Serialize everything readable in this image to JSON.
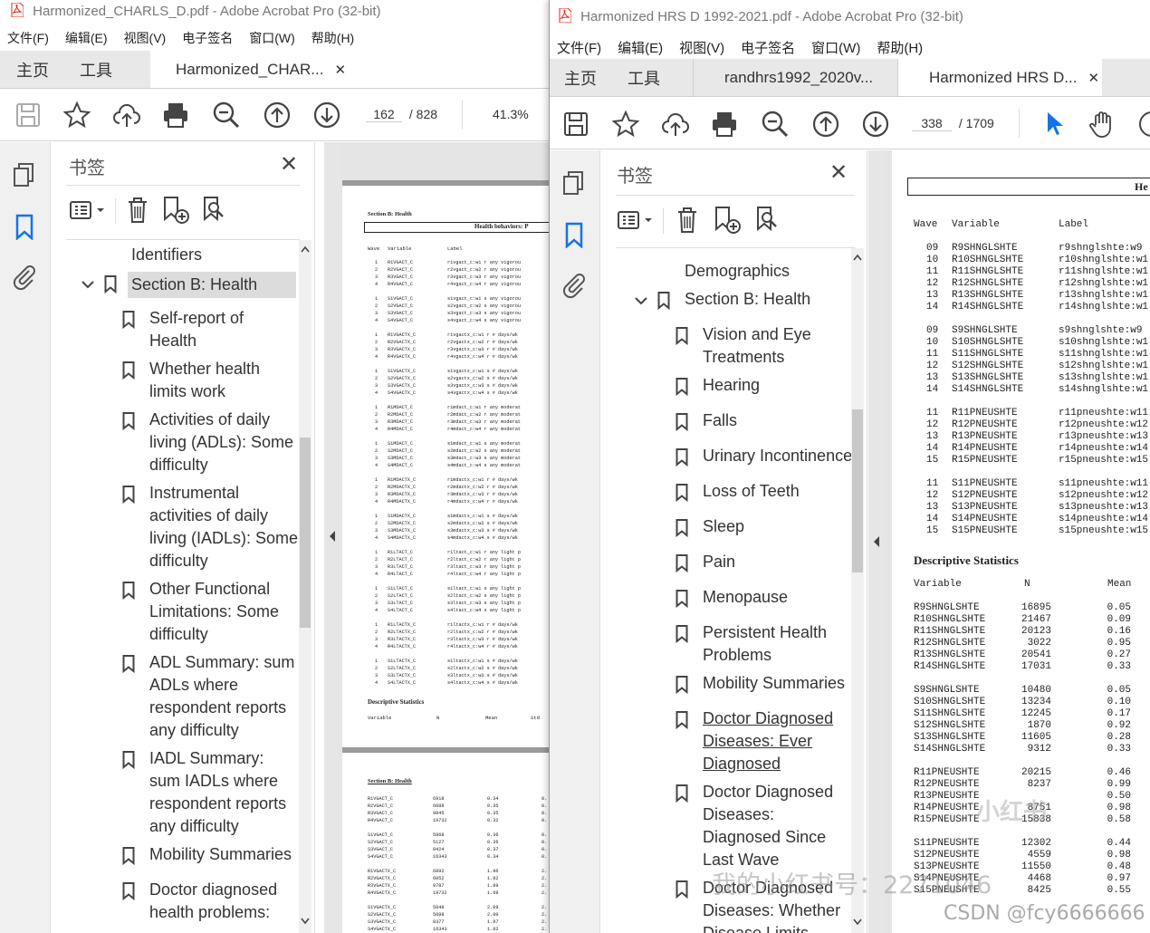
{
  "left_window": {
    "title": "Harmonized_CHARLS_D.pdf - Adobe Acrobat Pro (32-bit)",
    "menu": [
      "文件(F)",
      "编辑(E)",
      "视图(V)",
      "电子签名",
      "窗口(W)",
      "帮助(H)"
    ],
    "tabs": {
      "home": "主页",
      "tools": "工具",
      "doc": "Harmonized_CHAR..."
    },
    "page_current": "162",
    "page_total": "/ 828",
    "zoom": "41.3%",
    "bookmarks_title": "书签",
    "bookmarks": [
      {
        "label": "Identifiers",
        "lines": [
          "Identifiers"
        ]
      },
      {
        "label": "Section B: Health",
        "lines": [
          "Section B: Health"
        ]
      },
      {
        "lines": [
          "Self-report of",
          "Health"
        ]
      },
      {
        "lines": [
          "Whether health",
          "limits work"
        ]
      },
      {
        "lines": [
          "Activities of daily",
          "living (ADLs): Some",
          "difficulty"
        ]
      },
      {
        "lines": [
          "Instrumental",
          "activities of daily",
          "living (IADLs): Some",
          "difficulty"
        ]
      },
      {
        "lines": [
          "Other Functional",
          "Limitations: Some",
          "difficulty"
        ]
      },
      {
        "lines": [
          "ADL Summary: sum",
          "ADLs where",
          "respondent reports",
          "any difficulty"
        ]
      },
      {
        "lines": [
          "IADL Summary:",
          "sum IADLs where",
          "respondent reports",
          "any difficulty"
        ]
      },
      {
        "lines": [
          "Mobility Summaries"
        ]
      },
      {
        "lines": [
          "Doctor diagnosed",
          "health problems:"
        ]
      }
    ],
    "page1": {
      "section": "Section B: Health",
      "header": "Health behaviors: P",
      "col_wave": "Wave",
      "col_variable": "Variable",
      "col_label": "Label",
      "groups": [
        [
          [
            "1",
            "R1VGACT_C",
            "r1vgact_c:w1 r any vigorou"
          ],
          [
            "2",
            "R2VGACT_C",
            "r2vgact_c:w2 r any vigorou"
          ],
          [
            "3",
            "R3VGACT_C",
            "r3vgact_c:w3 r any vigorou"
          ],
          [
            "4",
            "R4VGACT_C",
            "r4vgact_c:w4 r any vigorou"
          ]
        ],
        [
          [
            "1",
            "S1VGACT_C",
            "s1vgact_c:w1 s any vigorou"
          ],
          [
            "2",
            "S2VGACT_C",
            "s2vgact_c:w2 s any vigorou"
          ],
          [
            "3",
            "S3VGACT_C",
            "s3vgact_c:w3 s any vigorou"
          ],
          [
            "4",
            "S4VGACT_C",
            "s4vgact_c:w4 s any vigorou"
          ]
        ],
        [
          [
            "1",
            "R1VGACTX_C",
            "r1vgactx_c:w1 r # days/wk"
          ],
          [
            "2",
            "R2VGACTX_C",
            "r2vgactx_c:w2 r # days/wk"
          ],
          [
            "3",
            "R3VGACTX_C",
            "r3vgactx_c:w3 r # days/wk"
          ],
          [
            "4",
            "R4VGACTX_C",
            "r4vgactx_c:w4 r # days/wk"
          ]
        ],
        [
          [
            "1",
            "S1VGACTX_C",
            "s1vgactx_c:w1 s # days/wk"
          ],
          [
            "2",
            "S2VGACTX_C",
            "s2vgactx_c:w2 s # days/wk"
          ],
          [
            "3",
            "S3VGACTX_C",
            "s3vgactx_c:w3 s # days/wk"
          ],
          [
            "4",
            "S4VGACTX_C",
            "s4vgactx_c:w4 s # days/wk"
          ]
        ],
        [
          [
            "1",
            "R1MDACT_C",
            "r1mdact_c:w1 r any moderat"
          ],
          [
            "2",
            "R2MDACT_C",
            "r2mdact_c:w2 r any moderat"
          ],
          [
            "3",
            "R3MDACT_C",
            "r3mdact_c:w3 r any moderat"
          ],
          [
            "4",
            "R4MDACT_C",
            "r4mdact_c:w4 r any moderat"
          ]
        ],
        [
          [
            "1",
            "S1MDACT_C",
            "s1mdact_c:w1 s any moderat"
          ],
          [
            "2",
            "S2MDACT_C",
            "s2mdact_c:w2 s any moderat"
          ],
          [
            "3",
            "S3MDACT_C",
            "s3mdact_c:w3 s any moderat"
          ],
          [
            "4",
            "S4MDACT_C",
            "s4mdact_c:w4 s any moderat"
          ]
        ],
        [
          [
            "1",
            "R1MDACTX_C",
            "r1mdactx_c:w1 r # days/wk"
          ],
          [
            "2",
            "R2MDACTX_C",
            "r2mdactx_c:w2 r # days/wk"
          ],
          [
            "3",
            "R3MDACTX_C",
            "r3mdactx_c:w3 r # days/wk"
          ],
          [
            "4",
            "R4MDACTX_C",
            "r4mdactx_c:w4 r # days/wk"
          ]
        ],
        [
          [
            "1",
            "S1MDACTX_C",
            "s1mdactx_c:w1 s # days/wk"
          ],
          [
            "2",
            "S2MDACTX_C",
            "s2mdactx_c:w2 s # days/wk"
          ],
          [
            "3",
            "S3MDACTX_C",
            "s3mdactx_c:w3 s # days/wk"
          ],
          [
            "4",
            "S4MDACTX_C",
            "s4mdactx_c:w4 s # days/wk"
          ]
        ],
        [
          [
            "1",
            "R1LTACT_C",
            "r1ltact_c:w1 r any light p"
          ],
          [
            "2",
            "R2LTACT_C",
            "r2ltact_c:w2 r any light p"
          ],
          [
            "3",
            "R3LTACT_C",
            "r3ltact_c:w3 r any light p"
          ],
          [
            "4",
            "R4LTACT_C",
            "r4ltact_c:w4 r any light p"
          ]
        ],
        [
          [
            "1",
            "S1LTACT_C",
            "s1ltact_c:w1 s any light p"
          ],
          [
            "2",
            "S2LTACT_C",
            "s2ltact_c:w2 s any light p"
          ],
          [
            "3",
            "S3LTACT_C",
            "s3ltact_c:w3 s any light p"
          ],
          [
            "4",
            "S4LTACT_C",
            "s4ltact_c:w4 s any light p"
          ]
        ],
        [
          [
            "1",
            "R1LTACTX_C",
            "r1ltactx_c:w1 r # days/wk"
          ],
          [
            "2",
            "R2LTACTX_C",
            "r2ltactx_c:w2 r # days/wk"
          ],
          [
            "3",
            "R3LTACTX_C",
            "r3ltactx_c:w3 r # days/wk"
          ],
          [
            "4",
            "R4LTACTX_C",
            "r4ltactx_c:w4 r # days/wk"
          ]
        ],
        [
          [
            "1",
            "S1LTACTX_C",
            "s1ltactx_c:w1 s # days/wk"
          ],
          [
            "2",
            "S2LTACTX_C",
            "s2ltactx_c:w2 s # days/wk"
          ],
          [
            "3",
            "S3LTACTX_C",
            "s3ltactx_c:w3 s # days/wk"
          ],
          [
            "4",
            "S4LTACTX_C",
            "s4ltactx_c:w4 s # days/wk"
          ]
        ]
      ],
      "desc_title": "Descriptive Statistics",
      "desc_cols": [
        "Variable",
        "N",
        "Mean",
        "Std"
      ]
    },
    "page2": {
      "section": "Section B: Health",
      "groups": [
        [
          [
            "R1VGACT_C",
            "6918",
            "0.34",
            "0."
          ],
          [
            "R2VGACT_C",
            "6088",
            "0.35",
            "0."
          ],
          [
            "R3VGACT_C",
            "9845",
            "0.35",
            "0."
          ],
          [
            "R4VGACT_C",
            "19732",
            "0.32",
            "0."
          ]
        ],
        [
          [
            "S1VGACT_C",
            "5868",
            "0.36",
            "0."
          ],
          [
            "S2VGACT_C",
            "5127",
            "0.36",
            "0."
          ],
          [
            "S3VGACT_C",
            "8424",
            "0.37",
            "0."
          ],
          [
            "S4VGACT_C",
            "16343",
            "0.34",
            "0."
          ]
        ],
        [
          [
            "R1VGACTX_C",
            "6892",
            "1.96",
            "2."
          ],
          [
            "R2VGACTX_C",
            "6052",
            "1.92",
            "2."
          ],
          [
            "R3VGACTX_C",
            "9787",
            "1.89",
            "2."
          ],
          [
            "R4VGACTX_C",
            "19732",
            "1.69",
            "2."
          ]
        ],
        [
          [
            "S1VGACTX_C",
            "5848",
            "2.09",
            "2."
          ],
          [
            "S2VGACTX_C",
            "5098",
            "2.00",
            "2."
          ],
          [
            "S3VGACTX_C",
            "8377",
            "1.97",
            "2."
          ],
          [
            "S4VGACTX_C",
            "16343",
            "1.82",
            "2."
          ]
        ]
      ]
    }
  },
  "right_window": {
    "title": "Harmonized HRS D 1992-2021.pdf - Adobe Acrobat Pro (32-bit)",
    "menu": [
      "文件(F)",
      "编辑(E)",
      "视图(V)",
      "电子签名",
      "窗口(W)",
      "帮助(H)"
    ],
    "tabs": {
      "home": "主页",
      "tools": "工具",
      "doc1": "randhrs1992_2020v...",
      "doc2": "Harmonized HRS D..."
    },
    "page_current": "338",
    "page_total": "/ 1709",
    "bookmarks_title": "书签",
    "bookmarks": [
      {
        "lines": [
          "Demographics"
        ]
      },
      {
        "lines": [
          "Section B: Health"
        ]
      },
      {
        "lines": [
          "Vision and Eye",
          "Treatments"
        ]
      },
      {
        "lines": [
          "Hearing"
        ]
      },
      {
        "lines": [
          "Falls"
        ]
      },
      {
        "lines": [
          "Urinary Incontinence"
        ]
      },
      {
        "lines": [
          "Loss of Teeth"
        ]
      },
      {
        "lines": [
          "Sleep"
        ]
      },
      {
        "lines": [
          "Pain"
        ]
      },
      {
        "lines": [
          "Menopause"
        ]
      },
      {
        "lines": [
          "Persistent Health",
          "Problems"
        ]
      },
      {
        "lines": [
          "Mobility Summaries"
        ]
      },
      {
        "lines": [
          "Doctor Diagnosed",
          "Diseases: Ever",
          "Diagnosed"
        ]
      },
      {
        "lines": [
          "Doctor Diagnosed",
          "Diseases:",
          "Diagnosed Since",
          "Last Wave"
        ]
      },
      {
        "lines": [
          "Doctor Diagnosed",
          "Diseases: Whether",
          "Disease Limits"
        ]
      }
    ],
    "page": {
      "header": "He",
      "col_wave": "Wave",
      "col_variable": "Variable",
      "col_label": "Label",
      "groups": [
        [
          [
            "09",
            "R9SHNGLSHTE",
            "r9shnglshte:w9"
          ],
          [
            "10",
            "R10SHNGLSHTE",
            "r10shnglshte:w1"
          ],
          [
            "11",
            "R11SHNGLSHTE",
            "r11shnglshte:w1"
          ],
          [
            "12",
            "R12SHNGLSHTE",
            "r12shnglshte:w1"
          ],
          [
            "13",
            "R13SHNGLSHTE",
            "r13shnglshte:w1"
          ],
          [
            "14",
            "R14SHNGLSHTE",
            "r14shnglshte:w1"
          ]
        ],
        [
          [
            "09",
            "S9SHNGLSHTE",
            "s9shnglshte:w9"
          ],
          [
            "10",
            "S10SHNGLSHTE",
            "s10shnglshte:w1"
          ],
          [
            "11",
            "S11SHNGLSHTE",
            "s11shnglshte:w1"
          ],
          [
            "12",
            "S12SHNGLSHTE",
            "s12shnglshte:w1"
          ],
          [
            "13",
            "S13SHNGLSHTE",
            "s13shnglshte:w1"
          ],
          [
            "14",
            "S14SHNGLSHTE",
            "s14shnglshte:w1"
          ]
        ],
        [
          [
            "11",
            "R11PNEUSHTE",
            "r11pneushte:w11"
          ],
          [
            "12",
            "R12PNEUSHTE",
            "r12pneushte:w12"
          ],
          [
            "13",
            "R13PNEUSHTE",
            "r13pneushte:w13"
          ],
          [
            "14",
            "R14PNEUSHTE",
            "r14pneushte:w14"
          ],
          [
            "15",
            "R15PNEUSHTE",
            "r15pneushte:w15"
          ]
        ],
        [
          [
            "11",
            "S11PNEUSHTE",
            "s11pneushte:w11"
          ],
          [
            "12",
            "S12PNEUSHTE",
            "s12pneushte:w12"
          ],
          [
            "13",
            "S13PNEUSHTE",
            "s13pneushte:w13"
          ],
          [
            "14",
            "S14PNEUSHTE",
            "s14pneushte:w14"
          ],
          [
            "15",
            "S15PNEUSHTE",
            "s15pneushte:w15"
          ]
        ]
      ],
      "desc_title": "Descriptive Statistics",
      "desc_cols": [
        "Variable",
        "N",
        "Mean"
      ],
      "desc_groups": [
        [
          [
            "R9SHNGLSHTE",
            "16895",
            "0.05"
          ],
          [
            "R10SHNGLSHTE",
            "21467",
            "0.09"
          ],
          [
            "R11SHNGLSHTE",
            "20123",
            "0.16"
          ],
          [
            "R12SHNGLSHTE",
            "3022",
            "0.95"
          ],
          [
            "R13SHNGLSHTE",
            "20541",
            "0.27"
          ],
          [
            "R14SHNGLSHTE",
            "17031",
            "0.33"
          ]
        ],
        [
          [
            "S9SHNGLSHTE",
            "10480",
            "0.05"
          ],
          [
            "S10SHNGLSHTE",
            "13234",
            "0.10"
          ],
          [
            "S11SHNGLSHTE",
            "12245",
            "0.17"
          ],
          [
            "S12SHNGLSHTE",
            "1870",
            "0.92"
          ],
          [
            "S13SHNGLSHTE",
            "11605",
            "0.28"
          ],
          [
            "S14SHNGLSHTE",
            "9312",
            "0.33"
          ]
        ],
        [
          [
            "R11PNEUSHTE",
            "20215",
            "0.46"
          ],
          [
            "R12PNEUSHTE",
            "8237",
            "0.99"
          ],
          [
            "R13PNEUSHTE",
            "",
            "0.50"
          ],
          [
            "R14PNEUSHTE",
            "8751",
            "0.98"
          ],
          [
            "R15PNEUSHTE",
            "15838",
            "0.58"
          ]
        ],
        [
          [
            "S11PNEUSHTE",
            "12302",
            "0.44"
          ],
          [
            "S12PNEUSHTE",
            "4559",
            "0.98"
          ],
          [
            "S13PNEUSHTE",
            "11550",
            "0.48"
          ],
          [
            "S14PNEUSHTE",
            "4468",
            "0.97"
          ],
          [
            "S15PNEUSHTE",
            "8425",
            "0.55"
          ]
        ]
      ]
    }
  },
  "watermarks": {
    "xiaohongshu": "小红书",
    "xhs_id": "我的小红书号：2271046",
    "csdn": "CSDN @fcy6666666"
  },
  "colors": {
    "accent_blue": "#1473e6",
    "acrobat_red": "#e0261b",
    "selected_bg": "#dcdcdc"
  }
}
